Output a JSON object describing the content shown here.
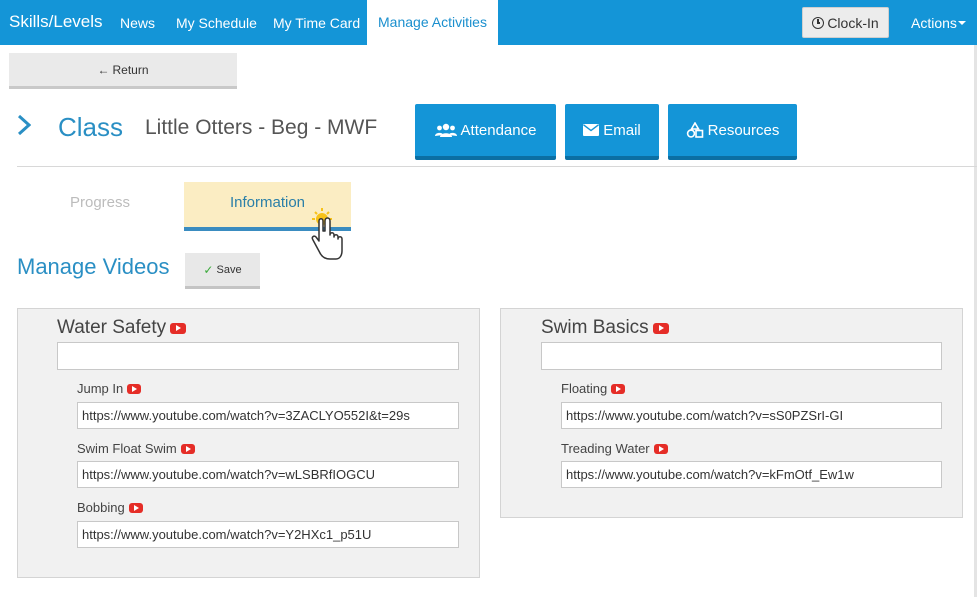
{
  "nav": {
    "brand": "Skills/Levels",
    "items": [
      "News",
      "My Schedule",
      "My Time Card"
    ],
    "active": "Manage Activities",
    "clockin": "Clock-In",
    "actions": "Actions"
  },
  "return_label": "Return",
  "header": {
    "title": "Class",
    "class_name": "Little Otters - Beg - MWF",
    "buttons": {
      "attendance": "Attendance",
      "email": "Email",
      "resources": "Resources"
    }
  },
  "tabs": {
    "progress": "Progress",
    "information": "Information"
  },
  "manage_videos": {
    "title": "Manage Videos",
    "save": "Save"
  },
  "groups": [
    {
      "title": "Water Safety",
      "url": "",
      "skills": [
        {
          "label": "Jump In",
          "url": "https://www.youtube.com/watch?v=3ZACLYO552I&t=29s"
        },
        {
          "label": "Swim Float Swim",
          "url": "https://www.youtube.com/watch?v=wLSBRfIOGCU"
        },
        {
          "label": "Bobbing",
          "url": "https://www.youtube.com/watch?v=Y2HXc1_p51U"
        }
      ]
    },
    {
      "title": "Swim Basics",
      "url": "",
      "skills": [
        {
          "label": "Floating",
          "url": "https://www.youtube.com/watch?v=sS0PZSrI-GI"
        },
        {
          "label": "Treading Water",
          "url": "https://www.youtube.com/watch?v=kFmOtf_Ew1w"
        }
      ]
    }
  ],
  "colors": {
    "primary": "#1495d7",
    "tab_active_bg": "#fbedc3",
    "youtube": "#e52d27"
  }
}
